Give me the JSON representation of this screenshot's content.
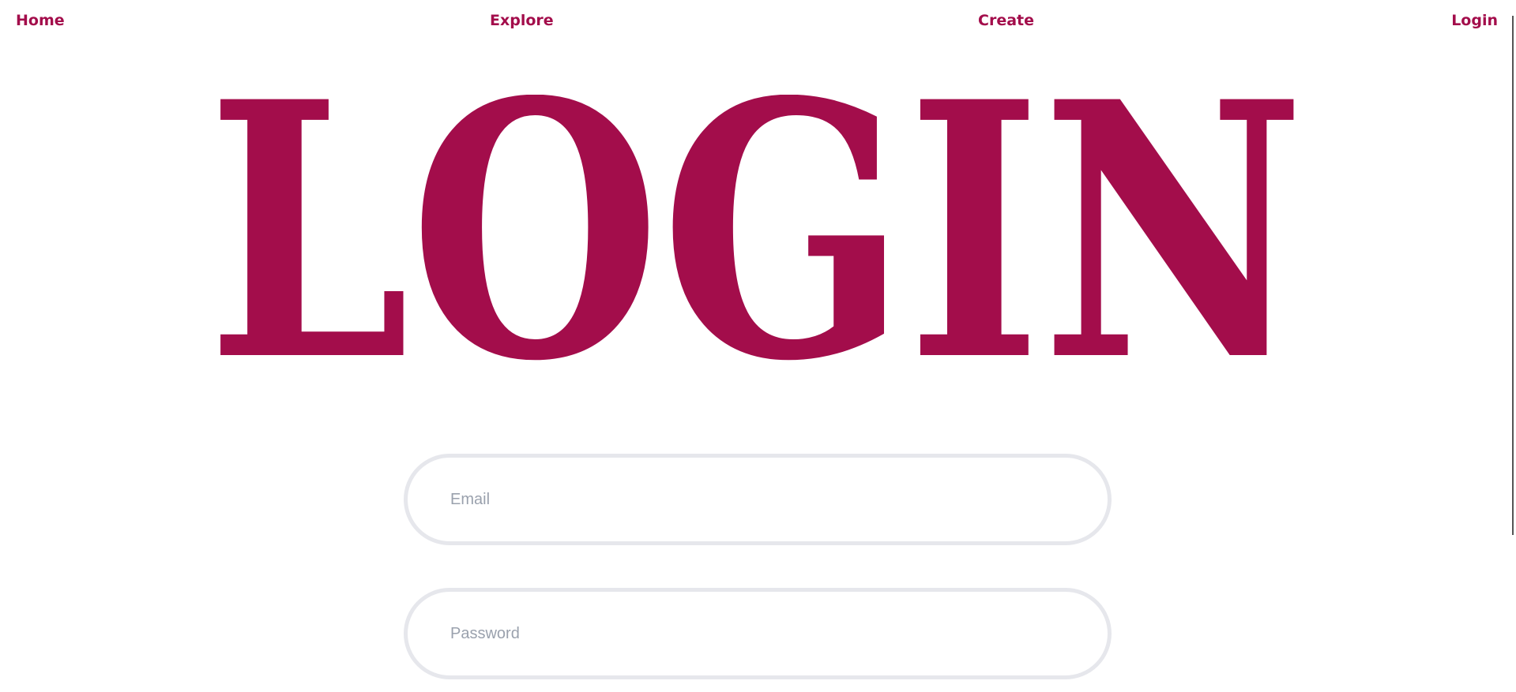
{
  "nav": {
    "home": "Home",
    "explore": "Explore",
    "create": "Create",
    "login": "Login"
  },
  "hero": {
    "title": "LOGIN",
    "color": "#a30d4b"
  },
  "form": {
    "email_placeholder": "Email",
    "email_value": "",
    "password_placeholder": "Password",
    "password_value": ""
  },
  "colors": {
    "accent": "#a30d4b",
    "input_border": "#e6e7ec",
    "placeholder": "#9aa1ad"
  }
}
